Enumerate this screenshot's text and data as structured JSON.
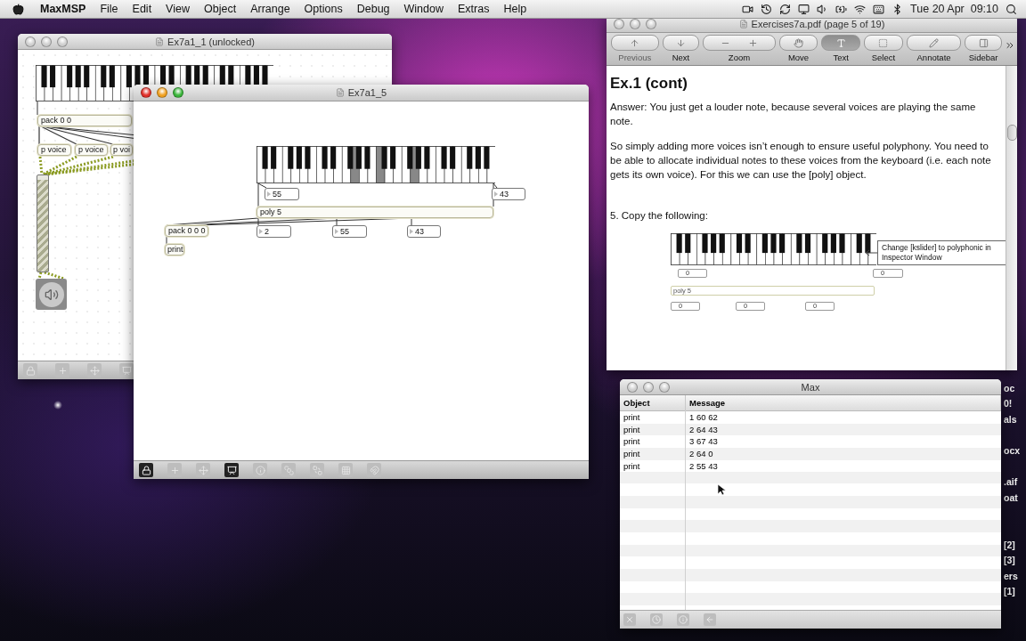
{
  "menu_bar": {
    "app": "MaxMSP",
    "menus": [
      "File",
      "Edit",
      "View",
      "Object",
      "Arrange",
      "Options",
      "Debug",
      "Window",
      "Extras",
      "Help"
    ],
    "clock": "Tue 20 Apr  09:10"
  },
  "desktop_labels": [
    "oc",
    "0!",
    "als",
    "ocx",
    ".aif",
    "oat",
    "[2]",
    "[3]",
    "ers",
    "[1]"
  ],
  "patch_back": {
    "title": "Ex7a1_1 (unlocked)",
    "active": false,
    "gain": {
      "level": 0.95
    },
    "objects": [
      {
        "kind": "object",
        "text": "pack 0 0"
      },
      {
        "kind": "object",
        "text": "p voice"
      },
      {
        "kind": "object",
        "text": "p voice"
      },
      {
        "kind": "object",
        "text": "p voi"
      }
    ]
  },
  "patch_front": {
    "title": "Ex7a1_5",
    "active": true,
    "objects": [
      {
        "kind": "number",
        "text": "55"
      },
      {
        "kind": "number",
        "text": "43"
      },
      {
        "kind": "object",
        "text": "poly 5"
      },
      {
        "kind": "object",
        "text": "pack 0 0 0"
      },
      {
        "kind": "number",
        "text": "2"
      },
      {
        "kind": "number",
        "text": "55"
      },
      {
        "kind": "number",
        "text": "43"
      },
      {
        "kind": "object",
        "text": "print"
      }
    ],
    "toolbar": [
      {
        "kind": "lock",
        "on": true
      },
      {
        "kind": "add",
        "on": false
      },
      {
        "kind": "move",
        "on": false
      },
      {
        "kind": "presentation",
        "on": true
      },
      {
        "kind": "info",
        "on": false
      },
      {
        "kind": "front",
        "on": false
      },
      {
        "kind": "back",
        "on": false
      },
      {
        "kind": "grid",
        "on": false
      },
      {
        "kind": "snap",
        "on": false
      }
    ]
  },
  "pdf_viewer": {
    "title": "Exercises7a.pdf (page 5 of 19)",
    "active": false,
    "toolbar": [
      {
        "kind": "pager",
        "label": "Previous",
        "disabled": true
      },
      {
        "kind": "pager",
        "label": "Next",
        "disabled": false
      },
      {
        "kind": "zoom",
        "label": "Zoom"
      },
      {
        "kind": "tool",
        "label": "Move",
        "selected": false
      },
      {
        "kind": "tool",
        "label": "Text",
        "selected": true
      },
      {
        "kind": "tool",
        "label": "Select",
        "selected": false
      },
      {
        "kind": "annotate",
        "label": "Annotate"
      },
      {
        "kind": "sidebar",
        "label": "Sidebar"
      }
    ],
    "heading": "Ex.1 (cont)",
    "paragraphs": [
      "Answer: You just get a louder note, because several voices are playing the same note.",
      "So simply adding more voices isn’t enough to ensure useful polyphony. You need to be able to allocate individual notes to these voices from the keyboard (i.e. each note gets its own voice). For this we can use the [poly] object.",
      "5. Copy the following:"
    ],
    "figure": {
      "callout": "Change [kslider] to polyphonic in Inspector Window",
      "numbers": [
        "0",
        "0",
        "0",
        "0",
        "0"
      ],
      "object": "poly 5"
    }
  },
  "console": {
    "title": "Max",
    "active": false,
    "columns": [
      "Object",
      "Message"
    ],
    "rows": [
      {
        "object": "print",
        "message": "1 60 62"
      },
      {
        "object": "print",
        "message": "2 64 43"
      },
      {
        "object": "print",
        "message": "3 67 43"
      },
      {
        "object": "print",
        "message": "2 64 0"
      },
      {
        "object": "print",
        "message": "2 55 43"
      }
    ]
  }
}
